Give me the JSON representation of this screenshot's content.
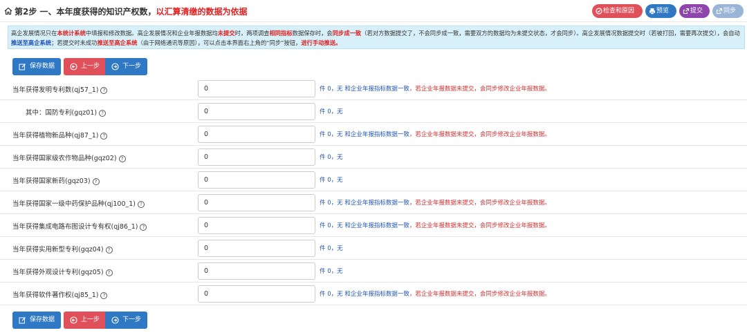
{
  "header": {
    "title_prefix": "第2步 一、本年度获得的知识产权数，",
    "title_highlight": "以汇算清缴的数据为依据",
    "buttons": {
      "check": "检查和原因",
      "preview": "预览",
      "submit": "提交",
      "sync": "同步"
    }
  },
  "notice": {
    "p1": "高企发展情况只在",
    "p2": "本统计系统",
    "p3": "中填报和修改数据。高企发展情况和企业年报数据均",
    "p4": "未提交",
    "p5": "时，两项调查",
    "p6": "相同指标",
    "p7": "数据保存时，会",
    "p8": "同步成一致",
    "p9": "（若对方数据提交了，不会同步成一致，需要双方的数据均为未提交状态，才会同步）。高企发展情况数据提交时（若被打回，需要再次提交），会自动",
    "p10": "推送至高企系统",
    "p11": "；若提交时未成功",
    "p12": "推送至高企系统",
    "p13": "（由于网络通讯等原因），可以点击本界面右上角的“同步”按钮，",
    "p14": "进行手动推送。"
  },
  "buttons": {
    "save": "保存数据",
    "prev": "上一步",
    "next": "下一步"
  },
  "note": {
    "unit_prefix": "件 0，无",
    "link_mid": " 和",
    "link_text": "企业年报指标数据一致",
    "warning": "，若企业年报数据未提交，会同步修改企业年报数据。"
  },
  "rows": [
    {
      "label": "当年获得发明专利数(qj57_1)",
      "value": "0"
    },
    {
      "label": "其中：国防专利(gqz01)",
      "value": "0"
    },
    {
      "label": "当年获得植物新品种(qj87_1)",
      "value": "0"
    },
    {
      "label": "当年获得国家级农作物品种(gqz02)",
      "value": "0"
    },
    {
      "label": "当年获得国家新药(gqz03)",
      "value": "0"
    },
    {
      "label": "当年获得国家一级中药保护品种(qj100_1)",
      "value": "0"
    },
    {
      "label": "当年获得集成电路布图设计专有权(qj86_1)",
      "value": "0"
    },
    {
      "label": "当年获得实用新型专利(gqz04)",
      "value": "0"
    },
    {
      "label": "当年获得外观设计专利(gqz05)",
      "value": "0"
    },
    {
      "label": "当年获得软件著作权(qj85_1)",
      "value": "0"
    }
  ],
  "colors": {
    "primary": "#2f78c4",
    "danger": "#e0505a",
    "purple": "#8e44ad",
    "sync": "#9bb5d8",
    "notice_bg": "#d8f0fa"
  }
}
